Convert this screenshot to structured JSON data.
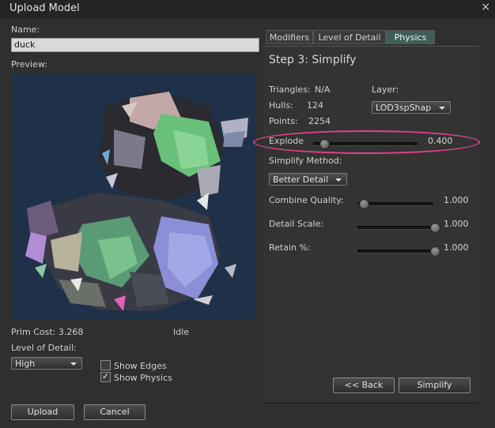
{
  "window": {
    "title": "Upload Model",
    "close_glyph": "×"
  },
  "left": {
    "name_label": "Name:",
    "name_value": "duck",
    "preview_label": "Preview:",
    "prim_cost": "Prim Cost: 3.268",
    "status": "Idle",
    "lod_label": "Level of Detail:",
    "lod_selected": "High",
    "show_edges": {
      "label": "Show Edges",
      "checked": false
    },
    "show_physics": {
      "label": "Show Physics",
      "checked": true
    },
    "upload_label": "Upload",
    "cancel_label": "Cancel"
  },
  "tabs": [
    {
      "label": "Modifiers",
      "active": false
    },
    {
      "label": "Level of Detail",
      "active": false
    },
    {
      "label": "Physics",
      "active": true
    }
  ],
  "physics": {
    "step_title": "Step 3: Simplify",
    "triangles_label": "Triangles:",
    "triangles_value": "N/A",
    "hulls_label": "Hulls:",
    "hulls_value": "124",
    "points_label": "Points:",
    "points_value": "2254",
    "layer_label": "Layer:",
    "layer_selected": "LOD3spShap",
    "explode": {
      "label": "Explode",
      "value": "0.400",
      "fraction": 0.08
    },
    "simplify_method_label": "Simplify Method:",
    "simplify_method_selected": "Better Detail",
    "combine_quality": {
      "label": "Combine Quality:",
      "value": "1.000",
      "fraction": 0.0
    },
    "detail_scale": {
      "label": "Detail Scale:",
      "value": "1.000",
      "fraction": 1.0
    },
    "retain": {
      "label": "Retain %:",
      "value": "1.000",
      "fraction": 1.0
    },
    "back_label": "<< Back",
    "simplify_label": "Simplify"
  },
  "colors": {
    "accent_tab": "#3e5e5b",
    "highlight_ellipse": "#e0408b",
    "preview_bg": "#1f3148"
  }
}
